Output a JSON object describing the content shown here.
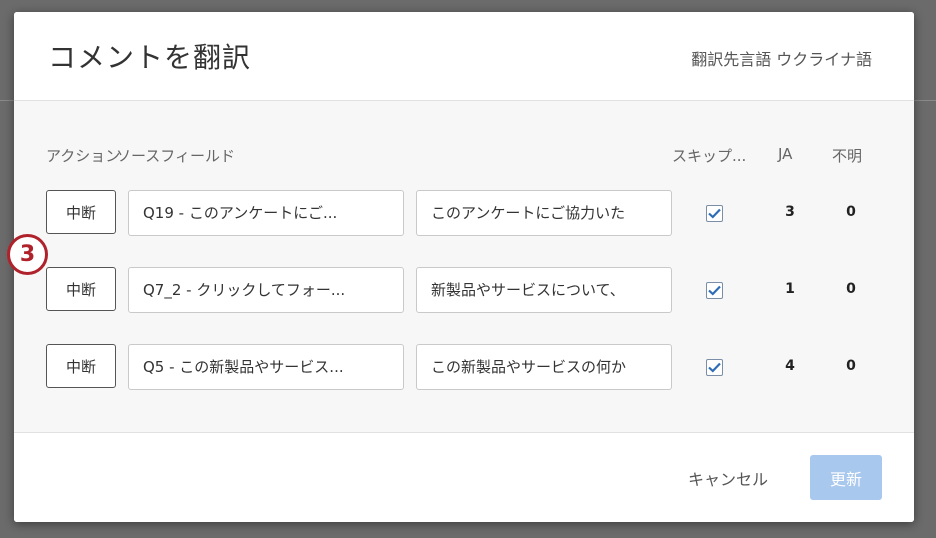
{
  "dialog": {
    "title": "コメントを翻訳",
    "target_language": "翻訳先言語 ウクライナ語"
  },
  "columns": {
    "action": "アクション",
    "source": "ソースフィールド",
    "skip": "スキップ...",
    "ja": "JA",
    "unknown": "不明"
  },
  "rows": [
    {
      "stop_label": "中断",
      "source": "Q19 - このアンケートにご...",
      "target": "このアンケートにご協力いた",
      "skip_checked": true,
      "ja": "3",
      "unknown": "0"
    },
    {
      "stop_label": "中断",
      "source": "Q7_2 - クリックしてフォー...",
      "target": "新製品やサービスについて、",
      "skip_checked": true,
      "ja": "1",
      "unknown": "0"
    },
    {
      "stop_label": "中断",
      "source": "Q5 - この新製品やサービス...",
      "target": "この新製品やサービスの何か",
      "skip_checked": true,
      "ja": "4",
      "unknown": "0"
    }
  ],
  "footer": {
    "cancel_label": "キャンセル",
    "update_label": "更新"
  },
  "step_badge": "3",
  "colors": {
    "accent_disabled": "#a9c8ee",
    "badge": "#b0222b",
    "checkbox": "#2d6db5"
  }
}
